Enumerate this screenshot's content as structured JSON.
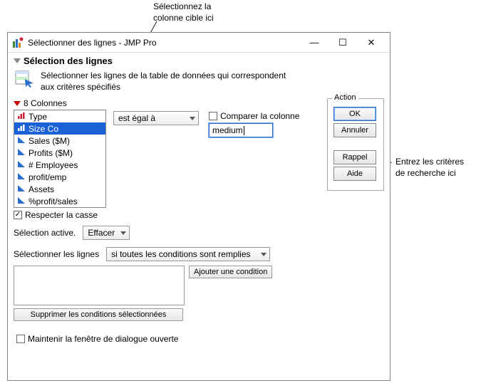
{
  "annotations": {
    "top": "Sélectionnez la\ncolonne cible ici",
    "right": "Entrez les critères\nde recherche ici"
  },
  "window": {
    "title": "Sélectionner des lignes - JMP Pro",
    "controls": {
      "min": "—",
      "max": "☐",
      "close": "✕"
    }
  },
  "section_title": "Sélection des lignes",
  "description": "Sélectionner les lignes de la table de données qui correspondent aux critères spécifiés",
  "action": {
    "legend": "Action",
    "ok": "OK",
    "cancel": "Annuler",
    "recall": "Rappel",
    "help": "Aide"
  },
  "compare_col_label": "Comparer la colonne",
  "compare_col_checked": false,
  "operator": "est égal à",
  "criteria_value": "medium",
  "columns_header": "8 Colonnes",
  "columns": [
    {
      "label": "Type",
      "icon": "nominal",
      "selected": false
    },
    {
      "label": "Size Co",
      "icon": "ordinal",
      "selected": true
    },
    {
      "label": "Sales ($M)",
      "icon": "continuous",
      "selected": false
    },
    {
      "label": "Profits ($M)",
      "icon": "continuous",
      "selected": false
    },
    {
      "label": "# Employees",
      "icon": "continuous",
      "selected": false
    },
    {
      "label": "profit/emp",
      "icon": "continuous",
      "selected": false
    },
    {
      "label": "Assets",
      "icon": "continuous",
      "selected": false
    },
    {
      "label": "%profit/sales",
      "icon": "continuous",
      "selected": false
    }
  ],
  "match_case_label": "Respecter la casse",
  "match_case_checked": true,
  "active_selection_label": "Sélection active.",
  "clear_label": "Effacer",
  "select_rows_label": "Sélectionner les lignes",
  "condition_mode": "si toutes les conditions sont remplies",
  "add_condition": "Ajouter une condition",
  "delete_conditions": "Supprimer les conditions sélectionnées",
  "keep_open_label": "Maintenir la fenêtre de dialogue ouverte",
  "keep_open_checked": false
}
